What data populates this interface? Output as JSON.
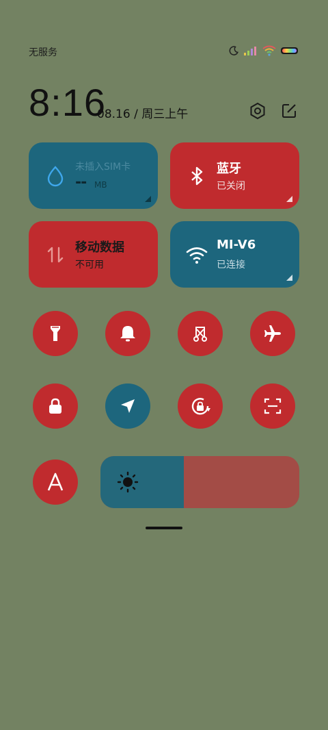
{
  "status_bar": {
    "carrier": "无服务",
    "icons": [
      "moon-icon",
      "signal-icon",
      "wifi-icon",
      "battery-icon"
    ]
  },
  "header": {
    "time": "8:16",
    "date": "08.16 / 周三上午",
    "icons": [
      "settings-icon",
      "edit-icon"
    ]
  },
  "tiles": {
    "data_usage": {
      "title": "未插入SIM卡",
      "value": "--",
      "unit": "MB",
      "icon": "water-drop-icon"
    },
    "bluetooth": {
      "title": "蓝牙",
      "status": "已关闭",
      "icon": "bluetooth-icon"
    },
    "mobile_data": {
      "title": "移动数据",
      "status": "不可用",
      "icon": "data-arrows-icon"
    },
    "wifi": {
      "title": "MI-V6",
      "status": "已连接",
      "icon": "wifi-icon"
    }
  },
  "toggles": [
    {
      "name": "flashlight",
      "icon": "flashlight-icon",
      "state": "off"
    },
    {
      "name": "ringer",
      "icon": "bell-icon",
      "state": "off"
    },
    {
      "name": "screenshot",
      "icon": "scissors-icon",
      "state": "off"
    },
    {
      "name": "airplane",
      "icon": "airplane-icon",
      "state": "off"
    },
    {
      "name": "lock-screen",
      "icon": "lock-icon",
      "state": "off"
    },
    {
      "name": "location",
      "icon": "location-arrow-icon",
      "state": "on"
    },
    {
      "name": "rotation-lock",
      "icon": "rotation-lock-icon",
      "state": "off"
    },
    {
      "name": "scanner",
      "icon": "scan-icon",
      "state": "off"
    },
    {
      "name": "auto-brightness",
      "icon": "letter-a-icon",
      "state": "off"
    }
  ],
  "brightness": {
    "level": 0.42,
    "icon": "sun-icon"
  },
  "colors": {
    "background": "#738262",
    "active": "#1d667d",
    "inactive": "#c02b2e"
  }
}
